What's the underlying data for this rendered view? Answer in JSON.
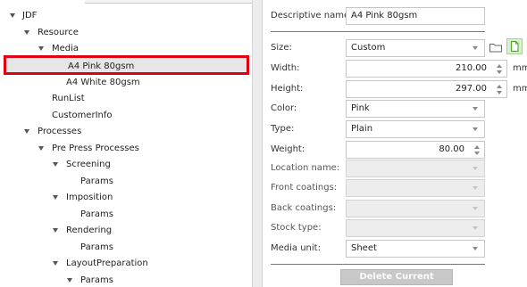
{
  "tree": {
    "items": [
      {
        "label": "JDF",
        "expanded": true
      },
      {
        "label": "Resource",
        "expanded": true
      },
      {
        "label": "Media",
        "expanded": true
      },
      {
        "label": "A4 Pink 80gsm",
        "selected": true
      },
      {
        "label": "A4 White 80gsm"
      },
      {
        "label": "RunList"
      },
      {
        "label": "CustomerInfo"
      },
      {
        "label": "Processes",
        "expanded": true
      },
      {
        "label": "Pre Press Processes",
        "expanded": true
      },
      {
        "label": "Screening",
        "expanded": true
      },
      {
        "label": "Params"
      },
      {
        "label": "Imposition",
        "expanded": true
      },
      {
        "label": "Params"
      },
      {
        "label": "Rendering",
        "expanded": true
      },
      {
        "label": "Params"
      },
      {
        "label": "LayoutPreparation",
        "expanded": true
      },
      {
        "label": "Params",
        "expanded": true
      }
    ]
  },
  "form": {
    "descriptive_name": {
      "label": "Descriptive name:",
      "value": "A4 Pink 80gsm"
    },
    "size": {
      "label": "Size:",
      "value": "Custom"
    },
    "width": {
      "label": "Width:",
      "value": "210.00",
      "unit": "mm"
    },
    "height": {
      "label": "Height:",
      "value": "297.00",
      "unit": "mm"
    },
    "color": {
      "label": "Color:",
      "value": "Pink"
    },
    "type": {
      "label": "Type:",
      "value": "Plain"
    },
    "weight": {
      "label": "Weight:",
      "value": "80.00"
    },
    "location_name": {
      "label": "Location name:",
      "value": ""
    },
    "front_coatings": {
      "label": "Front coatings:",
      "value": ""
    },
    "back_coatings": {
      "label": "Back coatings:",
      "value": ""
    },
    "stock_type": {
      "label": "Stock type:",
      "value": ""
    },
    "media_unit": {
      "label": "Media unit:",
      "value": "Sheet"
    },
    "delete_button": "Delete Current Medium"
  },
  "icons": {
    "open": "folder-icon",
    "new": "new-document-icon"
  },
  "colors": {
    "selection_border": "#e0000f",
    "new_icon_green": "#4caf2a"
  }
}
